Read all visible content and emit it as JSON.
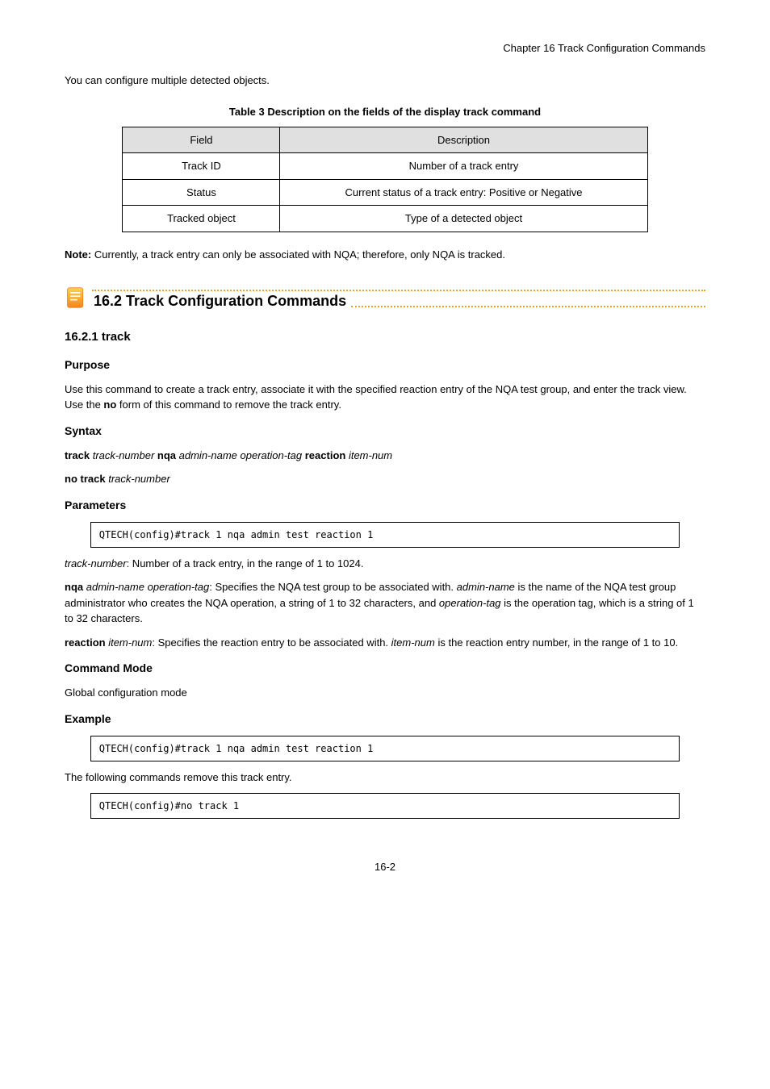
{
  "header": {
    "breadcrumb": "Chapter 16 Track Configuration Commands"
  },
  "intro_para": "You can configure multiple detected objects.",
  "table": {
    "caption": "Table 3 Description on the fields of the display track command",
    "header_field": "Field",
    "header_desc": "Description",
    "rows": [
      {
        "field": "Track ID",
        "desc": "Number of a track entry"
      },
      {
        "field": "Status",
        "desc": "Current status of a track entry: Positive or Negative"
      },
      {
        "field": "Tracked object",
        "desc": "Type of a detected object"
      }
    ]
  },
  "note": {
    "label": "Note: ",
    "text": "Currently, a track entry can only be associated with NQA; therefore, only NQA is tracked."
  },
  "section": {
    "number": "16.2 ",
    "title": "Track Configuration Commands"
  },
  "subsection": {
    "number": "16.2.1 ",
    "title": "track"
  },
  "purpose_label": "Purpose",
  "purpose_text1_a": "Use this command to create a track entry, associate it with the specified reaction entry of the NQA test group, and enter the track view. Use the ",
  "purpose_text1_bold": "no",
  "purpose_text1_b": " form of this command to remove the track entry.",
  "syntax_label": "Syntax",
  "syntax_track_number": "track-number ",
  "syntax_admin_name": "admin-name ",
  "syntax_operation_tag": "operation-tag ",
  "syntax_keyword_nqa": "nqa ",
  "syntax_keyword_reaction": "reaction ",
  "syntax_item_num": "item-num",
  "syntax_no_prefix": "no ",
  "syntax_no_track": "track ",
  "syntax_line1_prefix": "track ",
  "parameters_label": "Parameters",
  "param1_name": "track-number",
  "param1_desc": ": Number of a track entry, in the range of 1 to 1024.",
  "param2_prefix": "nqa ",
  "param2_admin": "admin-name",
  "param2_join": " ",
  "param2_op": "operation-tag",
  "param2_desc_a": ": Specifies the NQA test group to be associated with. ",
  "param2_desc_b": "admin-name",
  "param2_desc_c": " is the name of the NQA test group administrator who creates the NQA operation, a string of 1 to 32 characters, and ",
  "param2_desc_d": "operation-tag",
  "param2_desc_e": " is the operation tag, which is a string of 1 to 32 characters.",
  "param3_prefix": "reaction ",
  "param3_item": "item-num",
  "param3_desc_a": ": Specifies the reaction entry to be associated with. ",
  "param3_desc_b": "item-num",
  "param3_desc_c": " is the reaction entry number, in the range of 1 to 10.",
  "mode_label": "Command Mode",
  "mode_text": "Global configuration mode",
  "example_label": "Example",
  "example_code1": "QTECH(config)#track 1 nqa admin test reaction 1",
  "example_desc": "The following commands remove this track entry.",
  "example_code2": "QTECH(config)#no track 1",
  "footer_page": "16-2"
}
